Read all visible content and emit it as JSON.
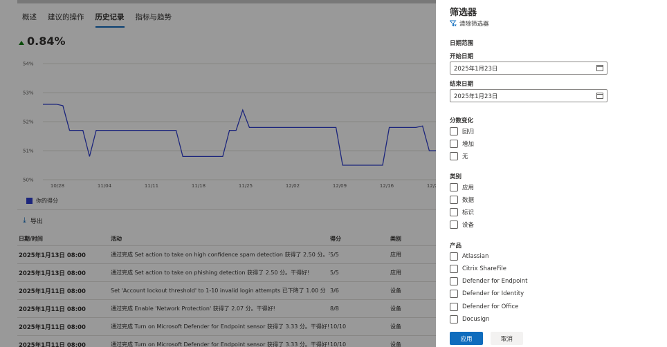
{
  "tabs": [
    {
      "label": "概述"
    },
    {
      "label": "建议的操作"
    },
    {
      "label": "历史记录",
      "active": true
    },
    {
      "label": "指标与趋势"
    }
  ],
  "score": "0.84%",
  "accent_color": "#2f3ecf",
  "chart_data": {
    "type": "line",
    "y_ticks": [
      "54%",
      "53%",
      "52%",
      "51%",
      "50%"
    ],
    "ylim": [
      50,
      54
    ],
    "x_ticks": [
      "10/28",
      "11/04",
      "11/11",
      "11/18",
      "11/25",
      "12/02",
      "12/09",
      "12/16",
      "12/23"
    ],
    "series": [
      {
        "name": "你的得分",
        "x": [
          0,
          2,
          3,
          4,
          6,
          7,
          8,
          10,
          11,
          12,
          13,
          14,
          15,
          16,
          17,
          18,
          19,
          20,
          21,
          22,
          23,
          24,
          25,
          26,
          27,
          28,
          29,
          30,
          31,
          32,
          33,
          34,
          35,
          36,
          37,
          38,
          39,
          40,
          41,
          42,
          43,
          44,
          45,
          46,
          47,
          48,
          49,
          50,
          51,
          52,
          53,
          54,
          55,
          56,
          57,
          58,
          59
        ],
        "y": [
          52.6,
          52.6,
          52.55,
          51.7,
          51.7,
          50.8,
          51.7,
          51.7,
          51.7,
          51.7,
          51.7,
          51.7,
          51.7,
          51.7,
          51.7,
          51.7,
          51.7,
          51.7,
          50.8,
          50.8,
          50.8,
          50.8,
          50.8,
          50.8,
          50.8,
          51.7,
          51.7,
          52.4,
          51.8,
          51.8,
          51.8,
          51.8,
          51.8,
          51.8,
          51.8,
          51.8,
          51.8,
          51.8,
          51.8,
          51.8,
          51.8,
          51.8,
          50.5,
          50.5,
          50.5,
          50.5,
          50.5,
          50.5,
          50.5,
          51.8,
          51.8,
          51.8,
          51.8,
          51.8,
          51.85,
          51.0,
          51.0
        ]
      }
    ]
  },
  "legend_label": "你的得分",
  "export_label": "导出",
  "table": {
    "headers": [
      "日期/时间",
      "活动",
      "得分",
      "类别"
    ],
    "rows": [
      {
        "date": "2025年1月13日 08:00",
        "activity": "通过完成 Set action to take on high confidence spam detection 获得了 2.50 分。干得好!",
        "score": "5/5",
        "category": "应用"
      },
      {
        "date": "2025年1月13日 08:00",
        "activity": "通过完成 Set action to take on phishing detection 获得了 2.50 分。干得好!",
        "score": "5/5",
        "category": "应用"
      },
      {
        "date": "2025年1月11日 08:00",
        "activity": "Set 'Account lockout threshold' to 1-10 invalid login attempts 已下降了 1.00 分",
        "score": "3/6",
        "category": "设备"
      },
      {
        "date": "2025年1月11日 08:00",
        "activity": "通过完成 Enable 'Network Protection' 获得了 2.07 分。干得好!",
        "score": "8/8",
        "category": "设备"
      },
      {
        "date": "2025年1月11日 08:00",
        "activity": "通过完成 Turn on Microsoft Defender for Endpoint sensor 获得了 3.33 分。干得好!",
        "score": "10/10",
        "category": "设备"
      },
      {
        "date": "2025年1月11日 08:00",
        "activity": "通过完成 Turn on Microsoft Defender for Endpoint sensor 获得了 3.33 分。干得好!",
        "score": "10/10",
        "category": "设备"
      }
    ]
  },
  "filter": {
    "title": "筛选器",
    "clear_label": "清除筛选器",
    "date_range_label": "日期范围",
    "start_label": "开始日期",
    "start_value": "2025年1月23日",
    "end_label": "结束日期",
    "end_value": "2025年1月23日",
    "score_change_label": "分数变化",
    "score_change_options": [
      "回归",
      "增加",
      "无"
    ],
    "category_label": "类别",
    "category_options": [
      "应用",
      "数据",
      "标识",
      "设备"
    ],
    "product_label": "产品",
    "product_options": [
      "Atlassian",
      "Citrix ShareFile",
      "Defender for Endpoint",
      "Defender for Identity",
      "Defender for Office",
      "Docusign"
    ],
    "apply_label": "应用",
    "cancel_label": "取消"
  }
}
